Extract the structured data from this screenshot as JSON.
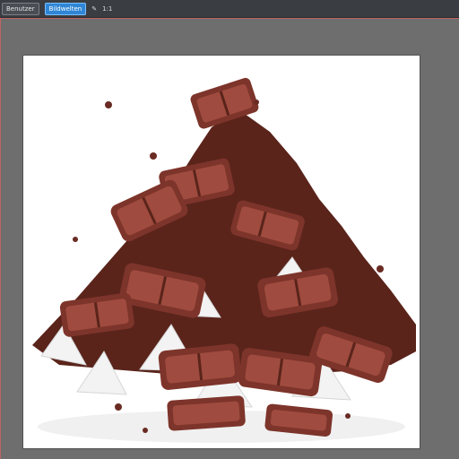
{
  "toolbar": {
    "file_chip": "Benutzer",
    "active_chip": "Bildwelten",
    "edit_icon": "pencil-icon",
    "zoom_text": "1:1"
  },
  "canvas": {
    "background_color": "#6e6e6e",
    "artboard_color": "#ffffff",
    "subject": "pile of chocolate bars and broken pieces with white sugar chunks"
  },
  "colors": {
    "chocolate_dark": "#5a241b",
    "chocolate_mid": "#7d342a",
    "chocolate_light": "#a04b3f",
    "sugar": "#f3f3f3"
  }
}
